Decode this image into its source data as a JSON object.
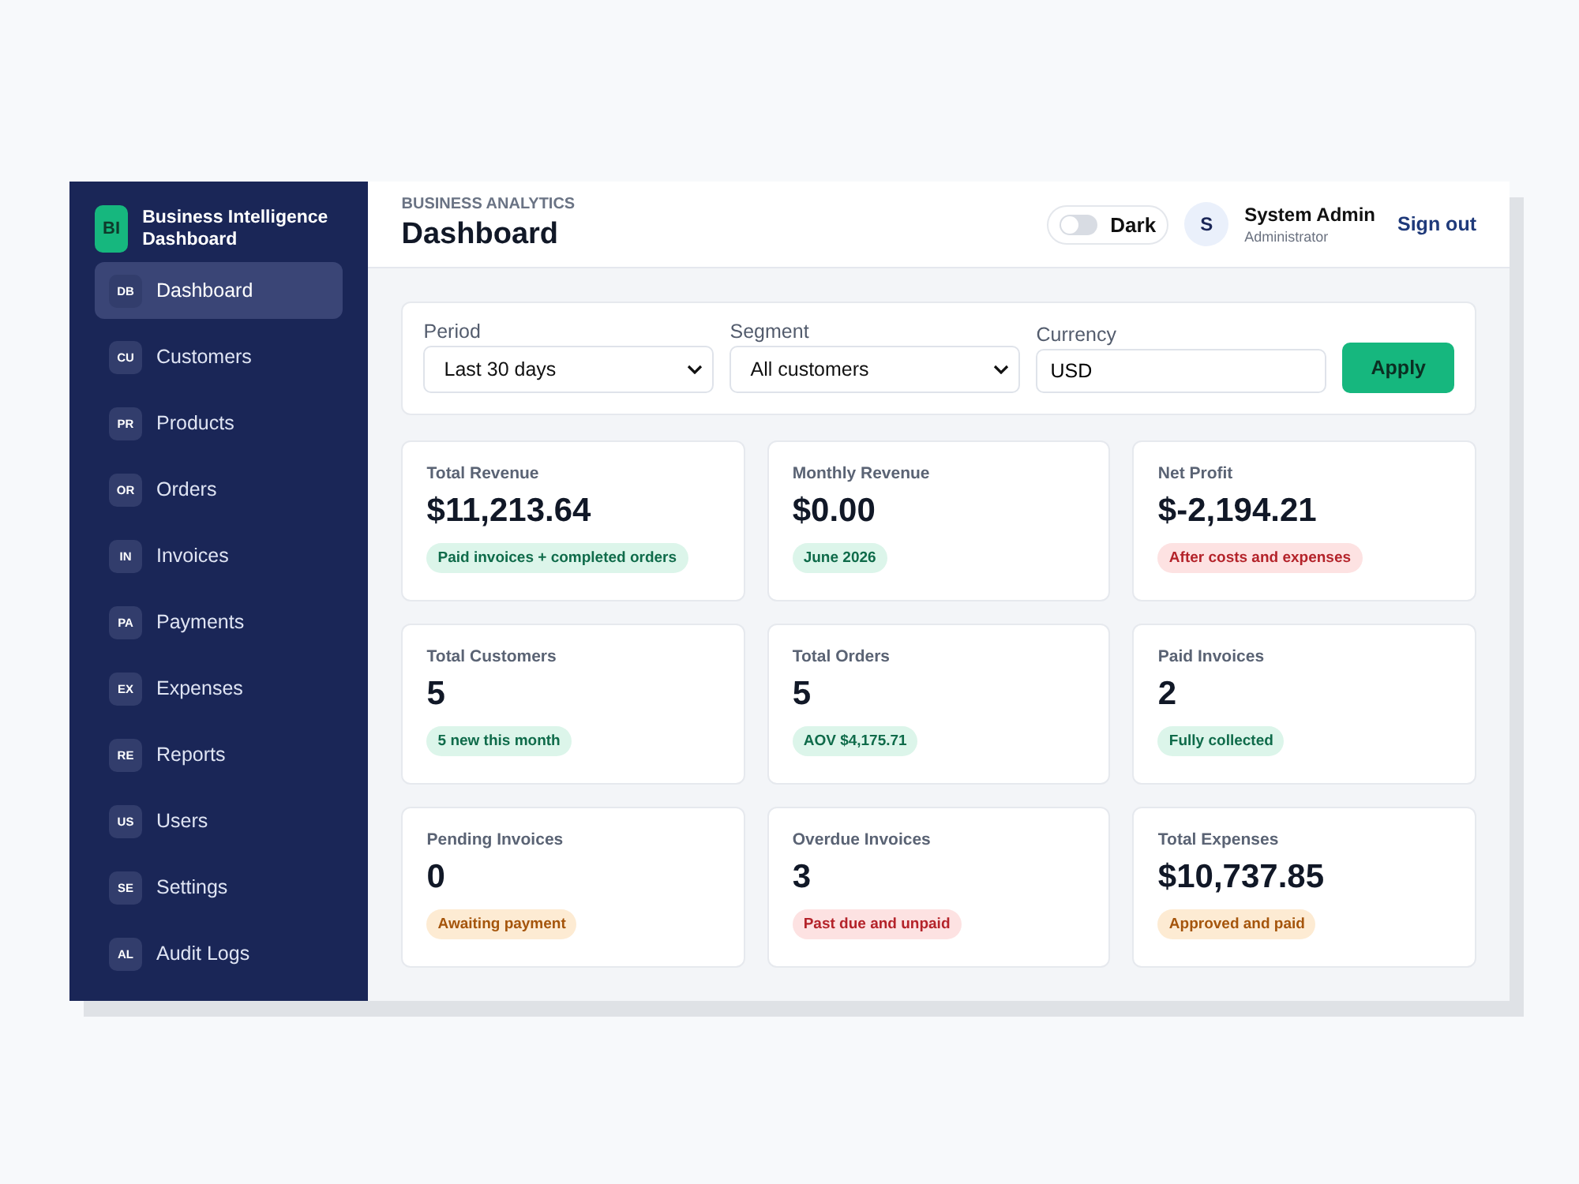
{
  "brand": {
    "logo": "BI",
    "title": "Business Intelligence Dashboard"
  },
  "sidebar": {
    "items": [
      {
        "abbr": "DB",
        "label": "Dashboard",
        "selected": true
      },
      {
        "abbr": "CU",
        "label": "Customers",
        "selected": false
      },
      {
        "abbr": "PR",
        "label": "Products",
        "selected": false
      },
      {
        "abbr": "OR",
        "label": "Orders",
        "selected": false
      },
      {
        "abbr": "IN",
        "label": "Invoices",
        "selected": false
      },
      {
        "abbr": "PA",
        "label": "Payments",
        "selected": false
      },
      {
        "abbr": "EX",
        "label": "Expenses",
        "selected": false
      },
      {
        "abbr": "RE",
        "label": "Reports",
        "selected": false
      },
      {
        "abbr": "US",
        "label": "Users",
        "selected": false
      },
      {
        "abbr": "SE",
        "label": "Settings",
        "selected": false
      },
      {
        "abbr": "AL",
        "label": "Audit Logs",
        "selected": false
      }
    ]
  },
  "header": {
    "eyebrow": "BUSINESS ANALYTICS",
    "title": "Dashboard",
    "dark_toggle": {
      "label": "Dark",
      "on": false
    },
    "user": {
      "initial": "S",
      "name": "System Admin",
      "role": "Administrator"
    },
    "sign_out": "Sign out"
  },
  "filters": {
    "period": {
      "label": "Period",
      "value": "Last 30 days"
    },
    "segment": {
      "label": "Segment",
      "value": "All customers"
    },
    "currency": {
      "label": "Currency",
      "value": "USD"
    },
    "apply": "Apply"
  },
  "stats": [
    {
      "label": "Total Revenue",
      "value": "$11,213.64",
      "note": "Paid invoices + completed orders",
      "kind": "success"
    },
    {
      "label": "Monthly Revenue",
      "value": "$0.00",
      "note": "June 2026",
      "kind": "success"
    },
    {
      "label": "Net Profit",
      "value": "$-2,194.21",
      "note": "After costs and expenses",
      "kind": "danger"
    },
    {
      "label": "Total Customers",
      "value": "5",
      "note": "5 new this month",
      "kind": "success"
    },
    {
      "label": "Total Orders",
      "value": "5",
      "note": "AOV $4,175.71",
      "kind": "success"
    },
    {
      "label": "Paid Invoices",
      "value": "2",
      "note": "Fully collected",
      "kind": "success"
    },
    {
      "label": "Pending Invoices",
      "value": "0",
      "note": "Awaiting payment",
      "kind": "warning"
    },
    {
      "label": "Overdue Invoices",
      "value": "3",
      "note": "Past due and unpaid",
      "kind": "danger"
    },
    {
      "label": "Total Expenses",
      "value": "$10,737.85",
      "note": "Approved and paid",
      "kind": "warning"
    }
  ]
}
